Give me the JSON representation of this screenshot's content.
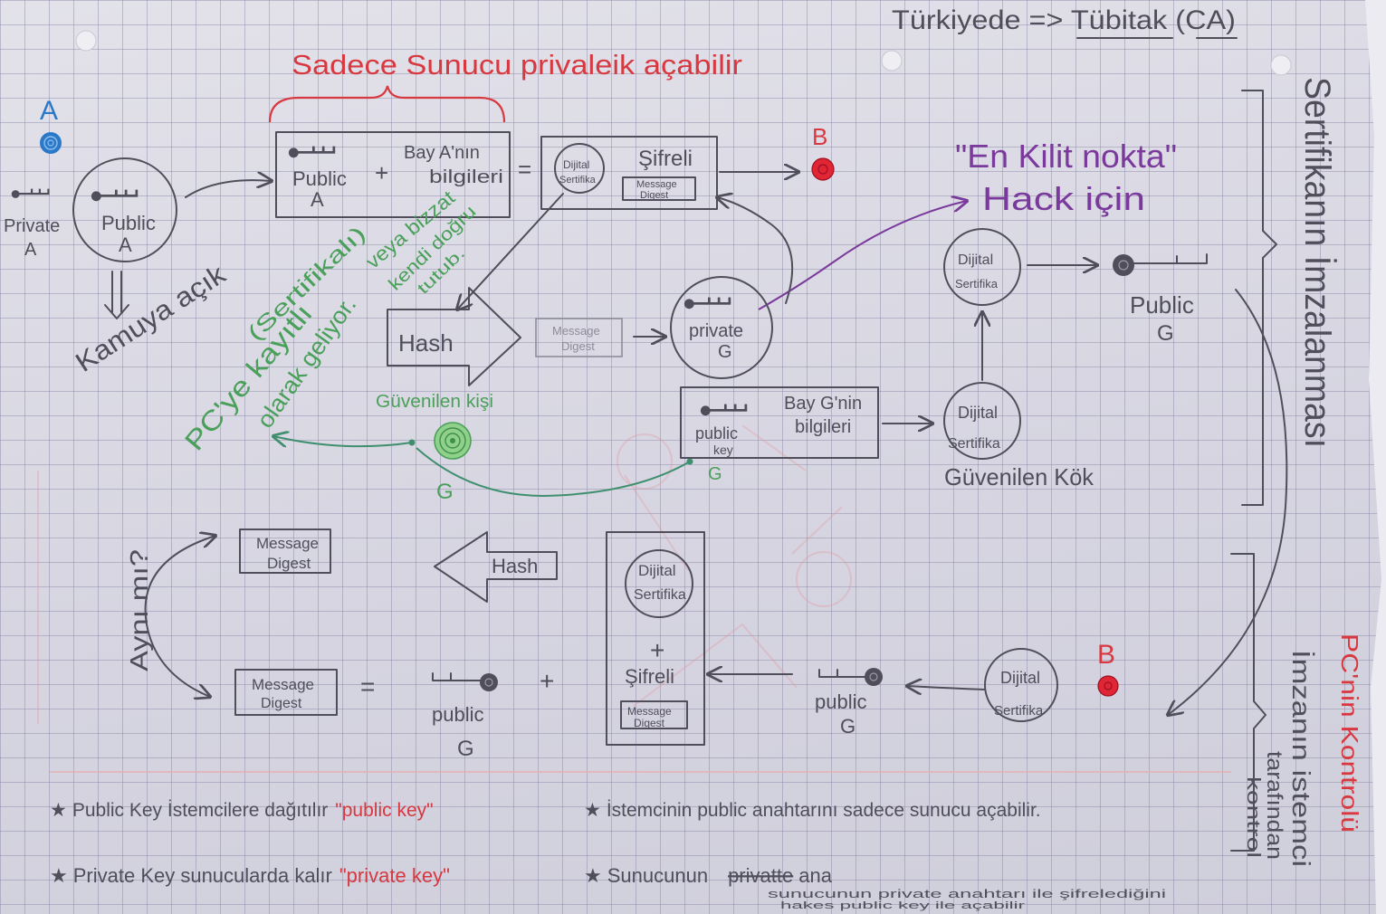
{
  "page": {
    "title_note": "Türkiyede => Tübitak (CA)",
    "server_only_note": "Sadece Sunucu privaleik açabilir"
  },
  "sender_a": {
    "label": "A",
    "private_key_label": "Private",
    "private_key_owner": "A",
    "public_key_label": "Public",
    "public_key_owner": "A",
    "public_note": "Kamuya açık"
  },
  "certificate_request": {
    "public_label": "Public",
    "owner": "A",
    "plus": "+",
    "info_line1": "Bay A'nın",
    "info_line2": "bilgileri",
    "equals": "="
  },
  "signed_package": {
    "cert_line1": "Dijital",
    "cert_line2": "Sertifika",
    "encrypted_label": "Şifreli",
    "digest_line1": "Message",
    "digest_line2": "Digest"
  },
  "recipient_top": {
    "label": "B"
  },
  "hack_note": {
    "line1": "\"En Kilit nokta\"",
    "line2": "Hack için"
  },
  "trusted_note": {
    "line1": "(Sertifikalı)",
    "line2": "veya bizzat",
    "line3": "kendi doğru",
    "line4": "tutub.",
    "line5": "PC'ye kayıtlı",
    "line6": "olarak geliyor."
  },
  "hash_step": {
    "label": "Hash",
    "digest_line1": "Message",
    "digest_line2": "Digest"
  },
  "private_g": {
    "label": "private",
    "owner": "G"
  },
  "trusted_person": {
    "label": "Güvenilen kişi",
    "owner": "G"
  },
  "root_request": {
    "public_label": "public",
    "key_label": "key",
    "info_line1": "Bay G'nin",
    "info_line2": "bilgileri",
    "owner_mark": "G"
  },
  "trusted_root": {
    "cert_line1": "Dijital",
    "cert_line2": "Sertifika",
    "label": "Güvenilen Kök"
  },
  "root_certificate": {
    "cert_line1": "Dijital",
    "cert_line2": "Sertifika",
    "public_label": "Public",
    "owner": "G"
  },
  "side_labels": {
    "signing": "Sertifikanın İmzalanması",
    "pc_check": "PC'nin Kontrolü",
    "client_line1": "İmzanın istemci",
    "client_line2": "tarafından",
    "client_line3": "kontrol"
  },
  "verification": {
    "same_question": "Aynı mı?",
    "digest_top_line1": "Message",
    "digest_top_line2": "Digest",
    "hash_label": "Hash",
    "package": {
      "cert_line1": "Dijital",
      "cert_line2": "Sertifika",
      "plus": "+",
      "encrypted_label": "Şifreli",
      "digest_line1": "Message",
      "digest_line2": "Digest"
    },
    "digest_bottom_line1": "Message",
    "digest_bottom_line2": "Digest",
    "equals": "=",
    "key1_label": "public",
    "key1_owner": "G",
    "plus": "+",
    "key2_label": "public",
    "key2_owner": "G",
    "cert_line1": "Dijital",
    "cert_line2": "Sertifika",
    "recipient_label": "B"
  },
  "notes": [
    {
      "bullet": "★",
      "text": "Public Key İstemcilere dağıtılır",
      "highlight": "\"public key\""
    },
    {
      "bullet": "★",
      "text": "İstemcinin public anahtarını sadece sunucu açabilir."
    },
    {
      "bullet": "★",
      "text": "Private Key sunucularda kalır",
      "highlight": "\"private key\""
    },
    {
      "bullet": "★",
      "text": "Sunucunun",
      "struck": "privatte",
      "tail": "ana",
      "sub_line1": "sunucunun private anahtarı ile şifrelediğini",
      "sub_line2": "hakes public key ile açabilir"
    }
  ],
  "colors": {
    "pencil": "#4f4e5a",
    "red": "#d8383f",
    "blue": "#2a78c7",
    "green": "#4aa05a",
    "purple": "#7a3a9b"
  }
}
